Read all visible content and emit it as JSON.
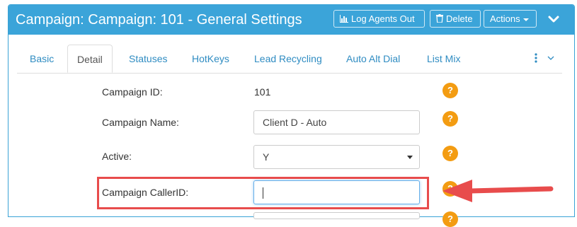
{
  "header": {
    "title": "Campaign: Campaign: 101 - General Settings",
    "buttons": {
      "log_agents_out": "Log Agents Out",
      "delete": "Delete",
      "actions": "Actions"
    }
  },
  "tabs": [
    "Basic",
    "Detail",
    "Statuses",
    "HotKeys",
    "Lead Recycling",
    "Auto Alt Dial",
    "List Mix"
  ],
  "active_tab": "Detail",
  "form": {
    "campaign_id": {
      "label": "Campaign ID:",
      "value": "101"
    },
    "campaign_name": {
      "label": "Campaign Name:",
      "value": "Client D - Auto"
    },
    "active": {
      "label": "Active:",
      "value": "Y"
    },
    "campaign_callerid": {
      "label": "Campaign CallerID:",
      "value": ""
    }
  },
  "help_symbol": "?",
  "colors": {
    "header_bg": "#3ba4d9",
    "link": "#2f8cc2",
    "help": "#f39c12",
    "highlight": "#e84c4c"
  }
}
